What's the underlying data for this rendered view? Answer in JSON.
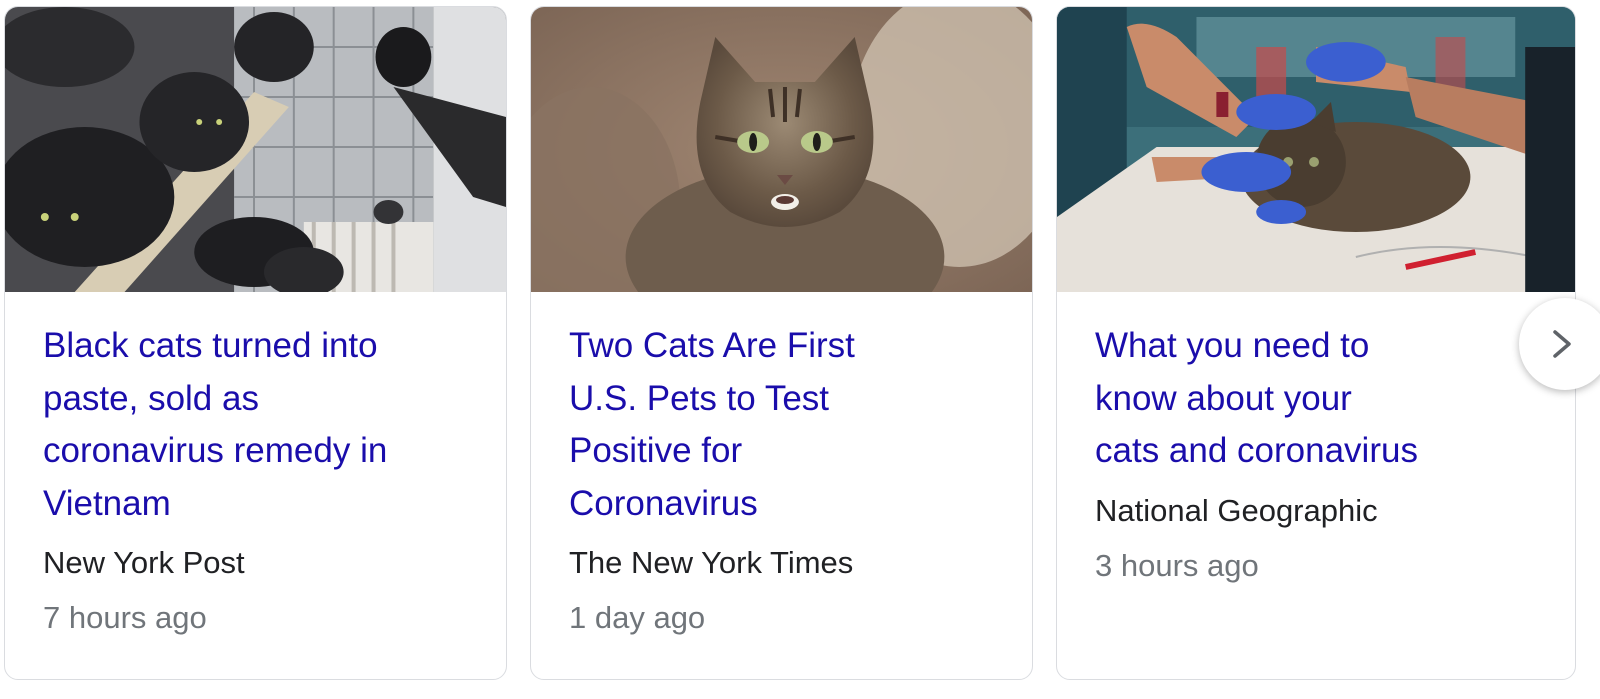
{
  "carousel": {
    "cards": [
      {
        "headline": "Black cats turned into paste, sold as coronavirus remedy in Vietnam",
        "source": "New York Post",
        "time": "7 hours ago",
        "image_icon": "black-cats-cage-photo"
      },
      {
        "headline": "Two Cats Are First U.S. Pets to Test Positive for Coronavirus",
        "source": "The New York Times",
        "time": "1 day ago",
        "image_icon": "tabby-cat-photo"
      },
      {
        "headline": "What you need to know about your cats and coronavirus",
        "source": "National Geographic",
        "time": "3 hours ago",
        "image_icon": "vet-examining-cat-photo"
      }
    ],
    "next_icon": "chevron-right-icon"
  },
  "colors": {
    "headline_link": "#1a0dab",
    "source_text": "#202124",
    "time_text": "#70757a",
    "card_border": "#dadce0"
  }
}
